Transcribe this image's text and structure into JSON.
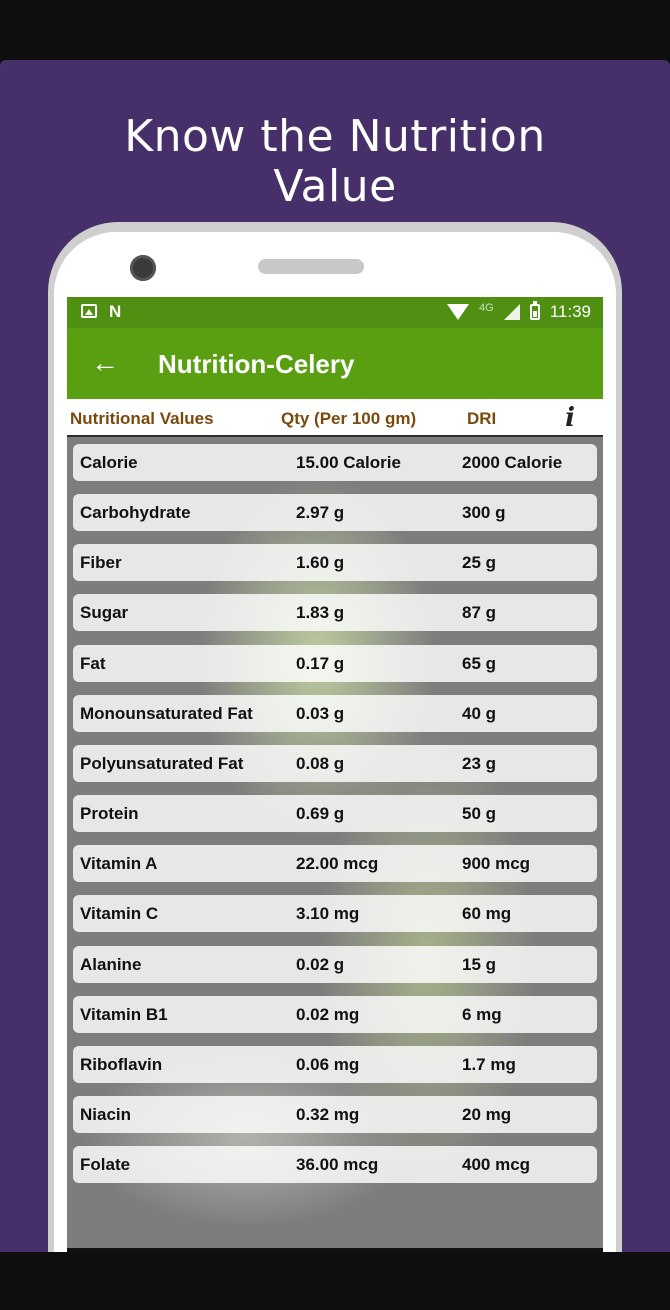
{
  "promo": {
    "headline_line1": "Know the Nutrition",
    "headline_line2": "Value",
    "background_color": "#47306a"
  },
  "status_bar": {
    "network": "4G",
    "time": "11:39",
    "color": "#4f9012"
  },
  "app_bar": {
    "back_icon": "arrow-left-icon",
    "title": "Nutrition-Celery",
    "color": "#5a9e12"
  },
  "table": {
    "headers": {
      "nutrient": "Nutritional Values",
      "qty": "Qty (Per 100 gm)",
      "dri": "DRI",
      "info_icon": "i"
    },
    "rows": [
      {
        "name": "Calorie",
        "qty": "15.00 Calorie",
        "dri": "2000 Calorie"
      },
      {
        "name": "Carbohydrate",
        "qty": "2.97 g",
        "dri": "300 g"
      },
      {
        "name": "Fiber",
        "qty": "1.60 g",
        "dri": "25 g"
      },
      {
        "name": "Sugar",
        "qty": "1.83 g",
        "dri": "87 g"
      },
      {
        "name": "Fat",
        "qty": "0.17 g",
        "dri": "65 g"
      },
      {
        "name": "Monounsaturated Fat",
        "qty": "0.03 g",
        "dri": "40 g"
      },
      {
        "name": "Polyunsaturated Fat",
        "qty": "0.08 g",
        "dri": "23 g"
      },
      {
        "name": "Protein",
        "qty": "0.69 g",
        "dri": "50 g"
      },
      {
        "name": "Vitamin A",
        "qty": "22.00 mcg",
        "dri": "900 mcg"
      },
      {
        "name": "Vitamin C",
        "qty": "3.10 mg",
        "dri": "60 mg"
      },
      {
        "name": "Alanine",
        "qty": "0.02 g",
        "dri": "15 g"
      },
      {
        "name": "Vitamin B1",
        "qty": "0.02 mg",
        "dri": "6 mg"
      },
      {
        "name": "Riboflavin",
        "qty": "0.06 mg",
        "dri": "1.7 mg"
      },
      {
        "name": "Niacin",
        "qty": "0.32 mg",
        "dri": "20 mg"
      },
      {
        "name": "Folate",
        "qty": "36.00 mcg",
        "dri": "400 mcg"
      }
    ]
  }
}
